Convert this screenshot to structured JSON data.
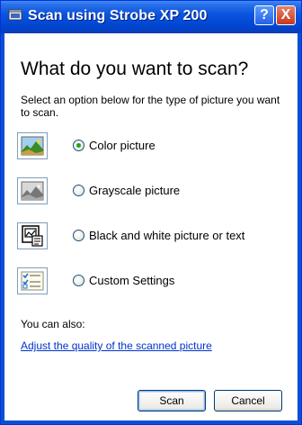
{
  "window": {
    "title": "Scan using Strobe XP 200",
    "help_label": "?",
    "close_label": "X"
  },
  "heading": "What do you want to scan?",
  "intro": "Select an option below for the type of picture you want to scan.",
  "options": [
    {
      "label": "Color picture",
      "selected": true,
      "icon": "color-picture-icon"
    },
    {
      "label": "Grayscale picture",
      "selected": false,
      "icon": "grayscale-picture-icon"
    },
    {
      "label": "Black and white picture or text",
      "selected": false,
      "icon": "black-white-picture-icon"
    },
    {
      "label": "Custom Settings",
      "selected": false,
      "icon": "custom-settings-icon"
    }
  ],
  "also_label": "You can also:",
  "adjust_link": "Adjust the quality of the scanned picture",
  "buttons": {
    "scan": "Scan",
    "cancel": "Cancel"
  }
}
